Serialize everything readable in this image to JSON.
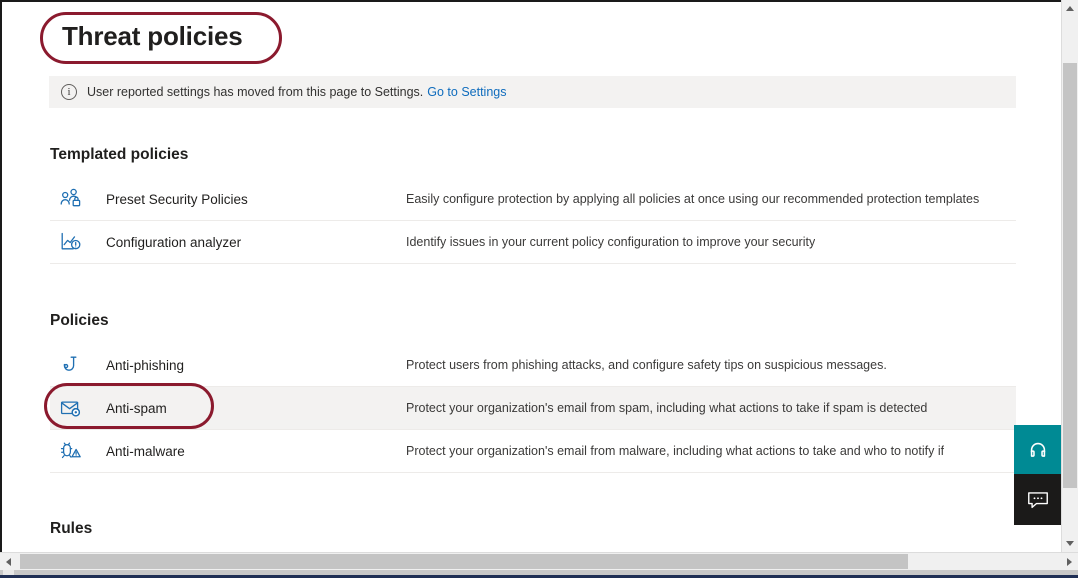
{
  "page": {
    "title": "Threat policies"
  },
  "notification": {
    "icon": "info-icon",
    "glyph": "i",
    "text": "User reported settings has moved from this page to Settings.",
    "link_label": "Go to Settings"
  },
  "sections": [
    {
      "id": "templated",
      "heading": "Templated policies"
    },
    {
      "id": "policies",
      "heading": "Policies"
    },
    {
      "id": "rules",
      "heading": "Rules"
    }
  ],
  "templated_policies": [
    {
      "icon": "people-lock-icon",
      "label": "Preset Security Policies",
      "description": "Easily configure protection by applying all policies at once using our recommended protection templates"
    },
    {
      "icon": "chart-alert-icon",
      "label": "Configuration analyzer",
      "description": "Identify issues in your current policy configuration to improve your security"
    }
  ],
  "policies": [
    {
      "icon": "fish-hook-icon",
      "label": "Anti-phishing",
      "description": "Protect users from phishing attacks, and configure safety tips on suspicious messages.",
      "selected": false
    },
    {
      "icon": "envelope-spam-icon",
      "label": "Anti-spam",
      "description": "Protect your organization's email from spam, including what actions to take if spam is detected",
      "selected": true
    },
    {
      "icon": "bug-warning-icon",
      "label": "Anti-malware",
      "description": "Protect your organization's email from malware, including what actions to take and who to notify if",
      "selected": false
    }
  ],
  "annotations": [
    {
      "target": "page-title",
      "shape": "oval",
      "color": "#8B1A2E"
    },
    {
      "target": "anti-spam-row",
      "shape": "oval",
      "color": "#8B1A2E"
    }
  ],
  "floating_buttons": [
    {
      "icon": "support-headset-icon",
      "color": "#008A94"
    },
    {
      "icon": "chat-bubble-icon",
      "color": "#1B1A19"
    }
  ],
  "scrollbars": {
    "vertical": {
      "up_icon": "scroll-up-arrow",
      "down_icon": "scroll-down-arrow"
    },
    "horizontal": {
      "left_icon": "scroll-left-arrow",
      "right_icon": "scroll-right-arrow"
    }
  },
  "colors": {
    "accent_link": "#0F6CBD",
    "icon_blue": "#1F6FB2",
    "annotation_red": "#8B1A2E",
    "selected_row": "#F3F2F1",
    "info_bar": "#F3F2F1"
  }
}
